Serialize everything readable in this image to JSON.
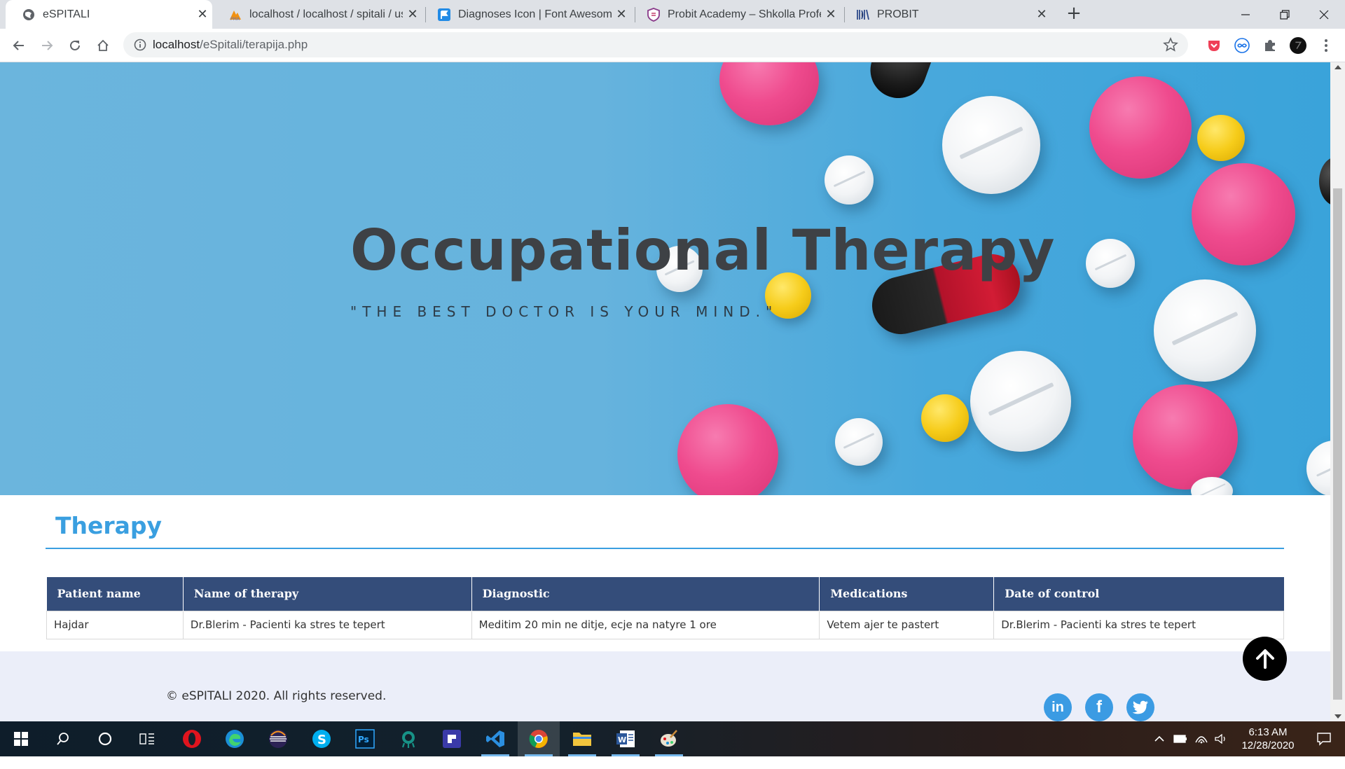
{
  "browser": {
    "tabs": [
      {
        "title": "eSPITALI",
        "active": true,
        "favicon": "globe-icon"
      },
      {
        "title": "localhost / localhost / spitali / us",
        "active": false,
        "favicon": "phpmyadmin-icon"
      },
      {
        "title": "Diagnoses Icon | Font Awesome",
        "active": false,
        "favicon": "flag-icon"
      },
      {
        "title": "Probit Academy – Shkolla Profes",
        "active": false,
        "favicon": "shield-icon"
      },
      {
        "title": "PROBIT",
        "active": false,
        "favicon": "probit-icon"
      }
    ],
    "new_tab_label": "+",
    "url_host": "localhost",
    "url_path": "/eSpitali/terapija.php"
  },
  "hero": {
    "title": "Occupational Therapy",
    "quote": "\"THE BEST DOCTOR IS YOUR MIND.\""
  },
  "therapy": {
    "title": "Therapy",
    "columns": [
      "Patient name",
      "Name of therapy",
      "Diagnostic",
      "Medications",
      "Date of control"
    ],
    "rows": [
      [
        "Hajdar",
        "Dr.Blerim - Pacienti ka stres te tepert",
        "Meditim 20 min ne ditje, ecje na natyre 1 ore",
        "Vetem ajer te pastert",
        "Dr.Blerim - Pacienti ka stres te tepert"
      ]
    ]
  },
  "footer": {
    "copyright": "© eSPITALI 2020. All rights reserved.",
    "social": [
      {
        "name": "linkedin-icon",
        "glyph": "in"
      },
      {
        "name": "facebook-icon",
        "glyph": "f"
      },
      {
        "name": "twitter-icon",
        "glyph": "t"
      }
    ]
  },
  "taskbar": {
    "time": "6:13 AM",
    "date": "12/28/2020"
  },
  "colors": {
    "accent": "#3a9fe0",
    "table_header": "#344d7a",
    "footer_bg": "#ebeef9"
  }
}
